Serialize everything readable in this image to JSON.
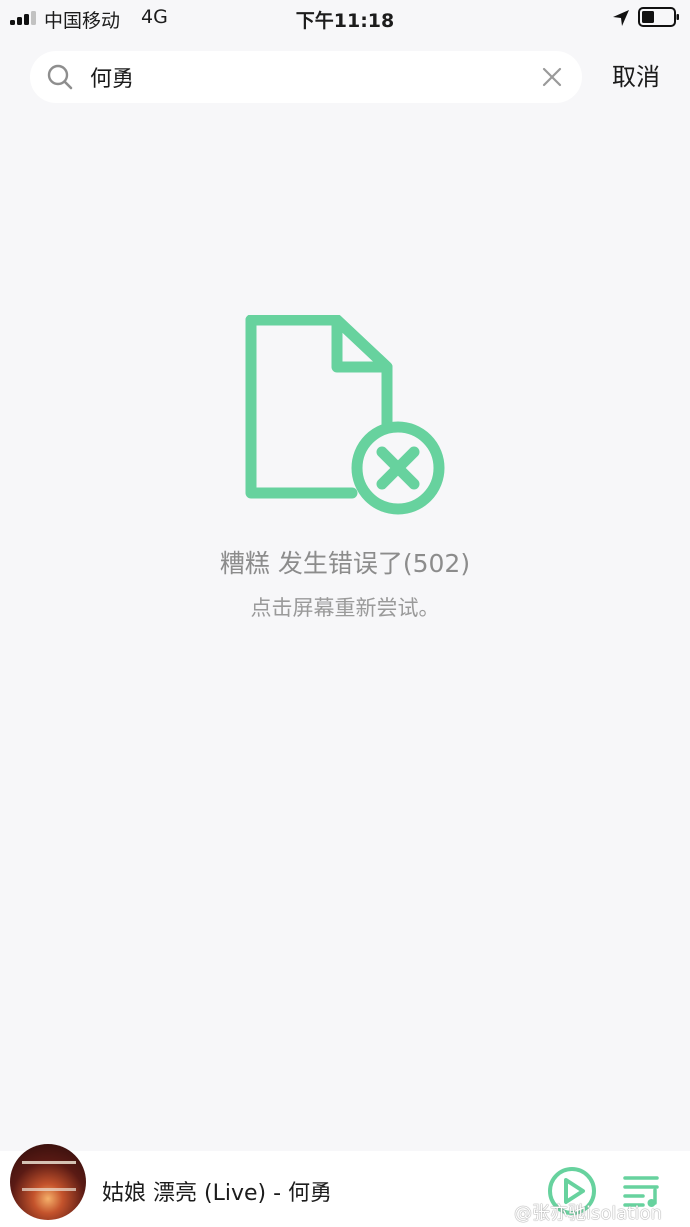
{
  "status_bar": {
    "carrier": "中国移动",
    "network": "4G",
    "time": "下午11:18"
  },
  "search": {
    "query": "何勇",
    "cancel_label": "取消"
  },
  "error": {
    "title": "糟糕 发生错误了(502)",
    "hint": "点击屏幕重新尝试。",
    "accent_color": "#67d29e"
  },
  "player": {
    "song": "姑娘 漂亮 (Live) - 何勇",
    "accent_color": "#67d29e"
  },
  "watermark": "@张亦驰isolation"
}
